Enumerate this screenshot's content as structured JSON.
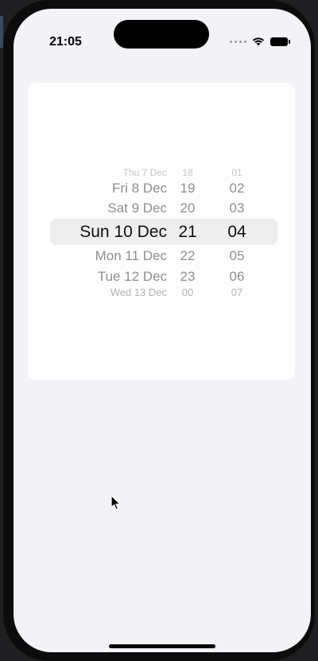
{
  "status_bar": {
    "time": "21:05",
    "icons": [
      "cellular-dots-icon",
      "wifi-icon",
      "battery-icon"
    ]
  },
  "picker": {
    "dates": [
      "Thu 7 Dec",
      "Fri 8 Dec",
      "Sat 9 Dec",
      "Sun 10 Dec",
      "Mon 11 Dec",
      "Tue 12 Dec",
      "Wed 13 Dec"
    ],
    "hours": [
      "18",
      "19",
      "20",
      "21",
      "22",
      "23",
      "00"
    ],
    "minutes": [
      "01",
      "02",
      "03",
      "04",
      "05",
      "06",
      "07"
    ],
    "selected_date": "Sun 10 Dec",
    "selected_hour": "21",
    "selected_minute": "04"
  },
  "colors": {
    "background": "#f2f2f7",
    "card": "#fdfdfd",
    "selection_band": "#eeeeef"
  }
}
